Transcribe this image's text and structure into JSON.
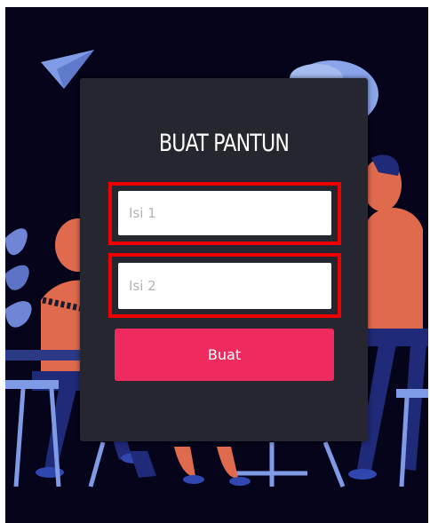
{
  "form": {
    "title": "BUAT PANTUN",
    "field1_placeholder": "Isi 1",
    "field2_placeholder": "Isi 2",
    "field1_value": "",
    "field2_value": "",
    "submit_label": "Buat"
  },
  "colors": {
    "background": "#05041a",
    "card": "#262631",
    "button": "#ef2a5e",
    "highlight_outline": "#ee0000",
    "illustration_blue": "#6f86d6",
    "illustration_orange": "#e06a4e"
  }
}
